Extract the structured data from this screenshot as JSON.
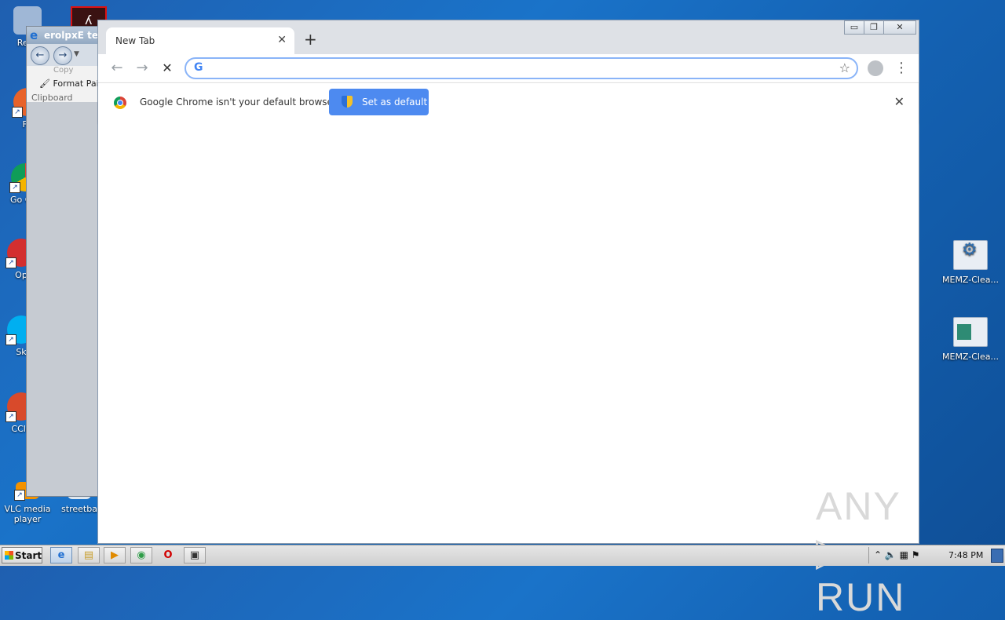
{
  "desktop": {
    "left_icons": [
      {
        "label": "Recy",
        "icon": "recycle-bin-icon",
        "color": "#9fb7d6"
      },
      {
        "label": "Fir",
        "icon": "firefox-icon",
        "color": "#e8632a"
      },
      {
        "label": "Go Chr",
        "icon": "chrome-icon",
        "color": "#2f9d48"
      },
      {
        "label": "Op",
        "icon": "opera-icon",
        "color": "#d32f2f"
      },
      {
        "label": "Sk",
        "icon": "skype-icon",
        "color": "#00aff0"
      },
      {
        "label": "CCle",
        "icon": "ccleaner-icon",
        "color": "#d84a2b"
      },
      {
        "label": "VLC media player",
        "icon": "vlc-icon",
        "color": "#f39200"
      },
      {
        "label": "streetba",
        "icon": "document-icon",
        "color": "#e0e8f0"
      }
    ],
    "right_icons": [
      {
        "label": "MEMZ-Clea...",
        "icon": "settings-file-icon"
      },
      {
        "label": "MEMZ-Clea...",
        "icon": "image-file-icon"
      }
    ]
  },
  "bg_window": {
    "title": "erolpxE ter",
    "ribbon_copy": "Copy",
    "format_painter": "Format Pai",
    "clipboard_label": "Clipboard"
  },
  "chrome": {
    "tab_title": "New Tab",
    "tab_close": "✕",
    "new_tab": "+",
    "controls": {
      "minimize": "▭",
      "restore": "❐",
      "close": "✕"
    },
    "back": "←",
    "forward": "→",
    "stop": "✕",
    "omnibox_value": "",
    "omnibox_g": "G",
    "star": "☆",
    "menu": "⋮",
    "infobar_text": "Google Chrome isn't your default browser",
    "set_default_label": "Set as default",
    "infobar_close": "✕",
    "watermark": "ANY ▷ RUN"
  },
  "taskbar": {
    "start_label": "Start",
    "apps": [
      {
        "name": "ie",
        "glyph": "e",
        "active": true
      },
      {
        "name": "explorer",
        "glyph": "▤",
        "active": false
      },
      {
        "name": "media-player",
        "glyph": "▶",
        "active": false
      },
      {
        "name": "chrome",
        "glyph": "◉",
        "active": false
      },
      {
        "name": "opera",
        "glyph": "O",
        "active": false
      },
      {
        "name": "app",
        "glyph": "▣",
        "active": false
      }
    ],
    "tray_icons": "⌃  🔈  ▦  ⚑",
    "clock": "7:48 PM"
  }
}
